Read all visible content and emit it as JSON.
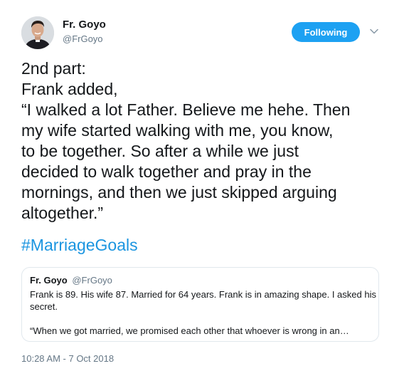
{
  "author": {
    "name": "Fr. Goyo",
    "handle": "@FrGoyo",
    "avatar_icon": "profile-photo"
  },
  "follow_button": {
    "label": "Following",
    "color": "#1da1f2"
  },
  "menu_icon": "chevron-down-icon",
  "tweet": {
    "lines": [
      "2nd part:",
      "Frank added,",
      "“I walked a lot Father. Believe me hehe. Then",
      "my wife started walking with me, you know,",
      "to be together. So after a while we just",
      "decided to walk together and pray in the",
      "mornings, and then we just skipped arguing",
      "altogether.”"
    ],
    "hashtag": "#MarriageGoals",
    "hashtag_color": "#1b95e0"
  },
  "quoted_tweet": {
    "name": "Fr. Goyo",
    "handle": "@FrGoyo",
    "lines": [
      "Frank is 89. His wife 87.  Married for 64 years. Frank is in amazing shape. I asked his",
      "secret."
    ],
    "last_line": "“When we got married,  we promised each other that whoever is wrong in an…"
  },
  "timestamp": "10:28 AM - 7 Oct 2018"
}
